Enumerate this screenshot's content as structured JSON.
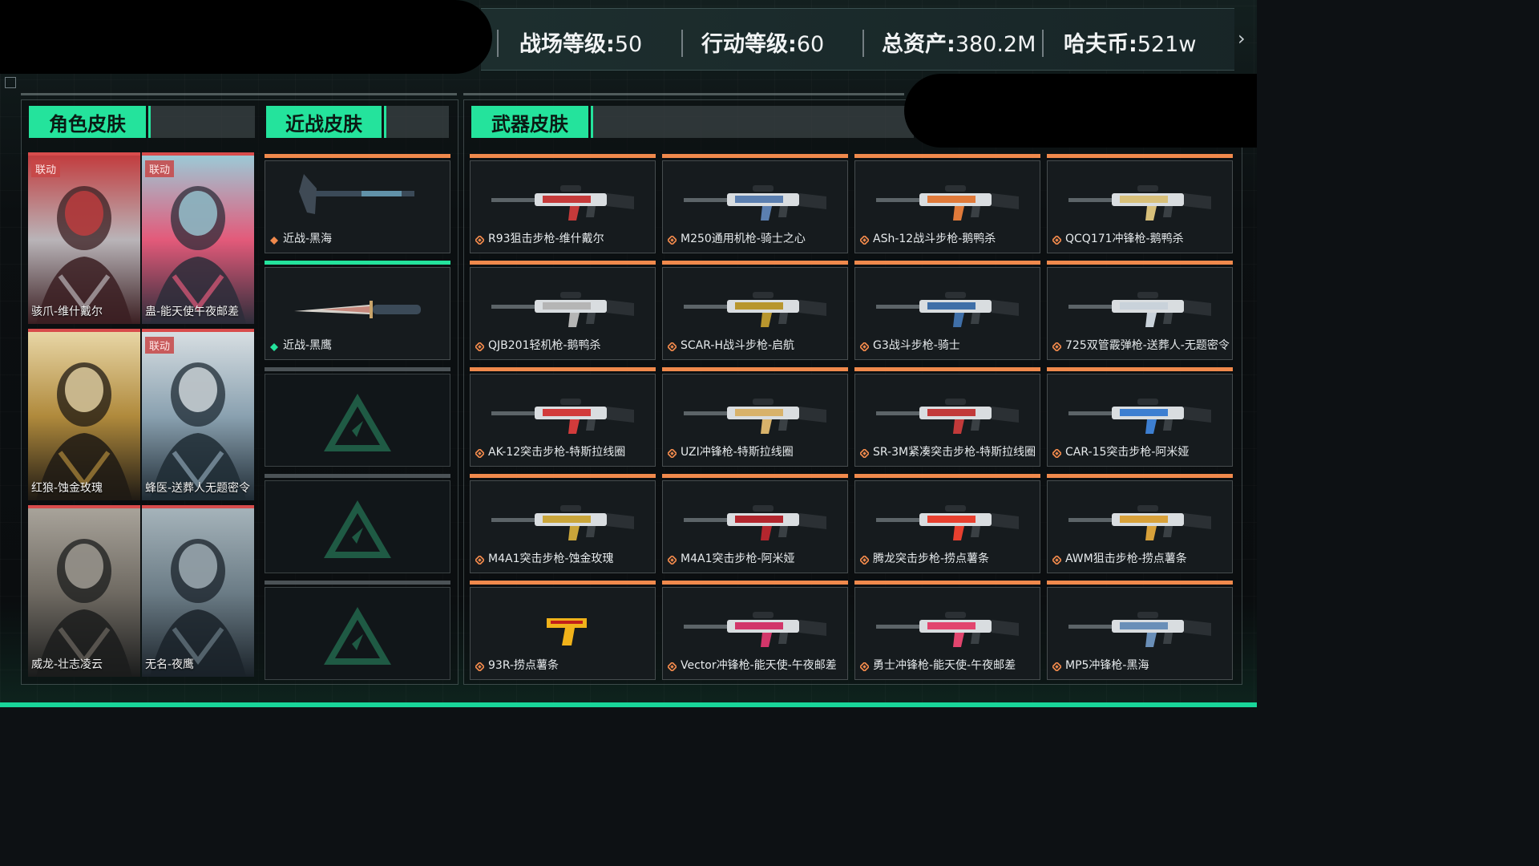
{
  "header": {
    "stats": [
      {
        "label": "战场等级:",
        "value": "50"
      },
      {
        "label": "行动等级:",
        "value": "60"
      },
      {
        "label": "总资产:",
        "value": "380.2M"
      },
      {
        "label": "哈夫币:",
        "value": "521w"
      }
    ]
  },
  "tabs": {
    "character": "角色皮肤",
    "melee": "近战皮肤",
    "weapon": "武器皮肤"
  },
  "characters": [
    {
      "name": "骇爪-维什戴尔",
      "badge": "联动",
      "palette": [
        "#b9b4b8",
        "#3b1f22",
        "#c23d3f"
      ]
    },
    {
      "name": "蛊-能天使午夜邮差",
      "badge": "联动",
      "palette": [
        "#e35a7a",
        "#2d2d3a",
        "#9cc9d6"
      ]
    },
    {
      "name": "红狼-蚀金玫瑰",
      "badge": "",
      "palette": [
        "#b08a3c",
        "#1f1a14",
        "#e8d6a6"
      ]
    },
    {
      "name": "蜂医-送葬人无题密令",
      "badge": "联动",
      "palette": [
        "#8aa1b0",
        "#1f2b34",
        "#d7dee2"
      ]
    },
    {
      "name": "威龙-壮志凌云",
      "badge": "",
      "palette": [
        "#6f6a62",
        "#1b1c1c",
        "#a8a39a"
      ]
    },
    {
      "name": "无名-夜鹰",
      "badge": "",
      "palette": [
        "#6b7c86",
        "#1a2229",
        "#a5b3ba"
      ]
    }
  ],
  "melee": [
    {
      "name": "近战-黑海",
      "type": "axe",
      "color": "#f0894c",
      "filled": true
    },
    {
      "name": "近战-黑鹰",
      "type": "knife",
      "color": "#24e39c",
      "filled": true
    },
    {
      "name": "",
      "filled": false
    },
    {
      "name": "",
      "filled": false
    },
    {
      "name": "",
      "filled": false
    }
  ],
  "weapons": [
    {
      "name": "R93狙击步枪-维什戴尔",
      "color": "#c53a3a"
    },
    {
      "name": "M250通用机枪-骑士之心",
      "color": "#5b7fb0"
    },
    {
      "name": "ASh-12战斗步枪-鹅鸭杀",
      "color": "#e07a3a"
    },
    {
      "name": "QCQ171冲锋枪-鹅鸭杀",
      "color": "#d8c07a"
    },
    {
      "name": "QJB201轻机枪-鹅鸭杀",
      "color": "#b5b5b5"
    },
    {
      "name": "SCAR-H战斗步枪-启航",
      "color": "#b8962e"
    },
    {
      "name": "G3战斗步枪-骑士",
      "color": "#3f6fa8"
    },
    {
      "name": "725双管霰弹枪-送葬人-无题密令",
      "color": "#c9d2da"
    },
    {
      "name": "AK-12突击步枪-特斯拉线圈",
      "color": "#d23b3b"
    },
    {
      "name": "UZI冲锋枪-特斯拉线圈",
      "color": "#d8b26a"
    },
    {
      "name": "SR-3M紧凑突击步枪-特斯拉线圈",
      "color": "#c23a3a"
    },
    {
      "name": "CAR-15突击步枪-阿米娅",
      "color": "#3d7fd1"
    },
    {
      "name": "M4A1突击步枪-蚀金玫瑰",
      "color": "#c9a53a"
    },
    {
      "name": "M4A1突击步枪-阿米娅",
      "color": "#b3262e"
    },
    {
      "name": "腾龙突击步枪-捞点薯条",
      "color": "#e8402f"
    },
    {
      "name": "AWM狙击步枪-捞点薯条",
      "color": "#d8a13a"
    },
    {
      "name": "93R-捞点薯条",
      "color": "#f0b21a"
    },
    {
      "name": "Vector冲锋枪-能天使-午夜邮差",
      "color": "#d2366a"
    },
    {
      "name": "勇士冲锋枪-能天使-午夜邮差",
      "color": "#e2456e"
    },
    {
      "name": "MP5冲锋枪-黑海",
      "color": "#6a8fb8"
    }
  ]
}
